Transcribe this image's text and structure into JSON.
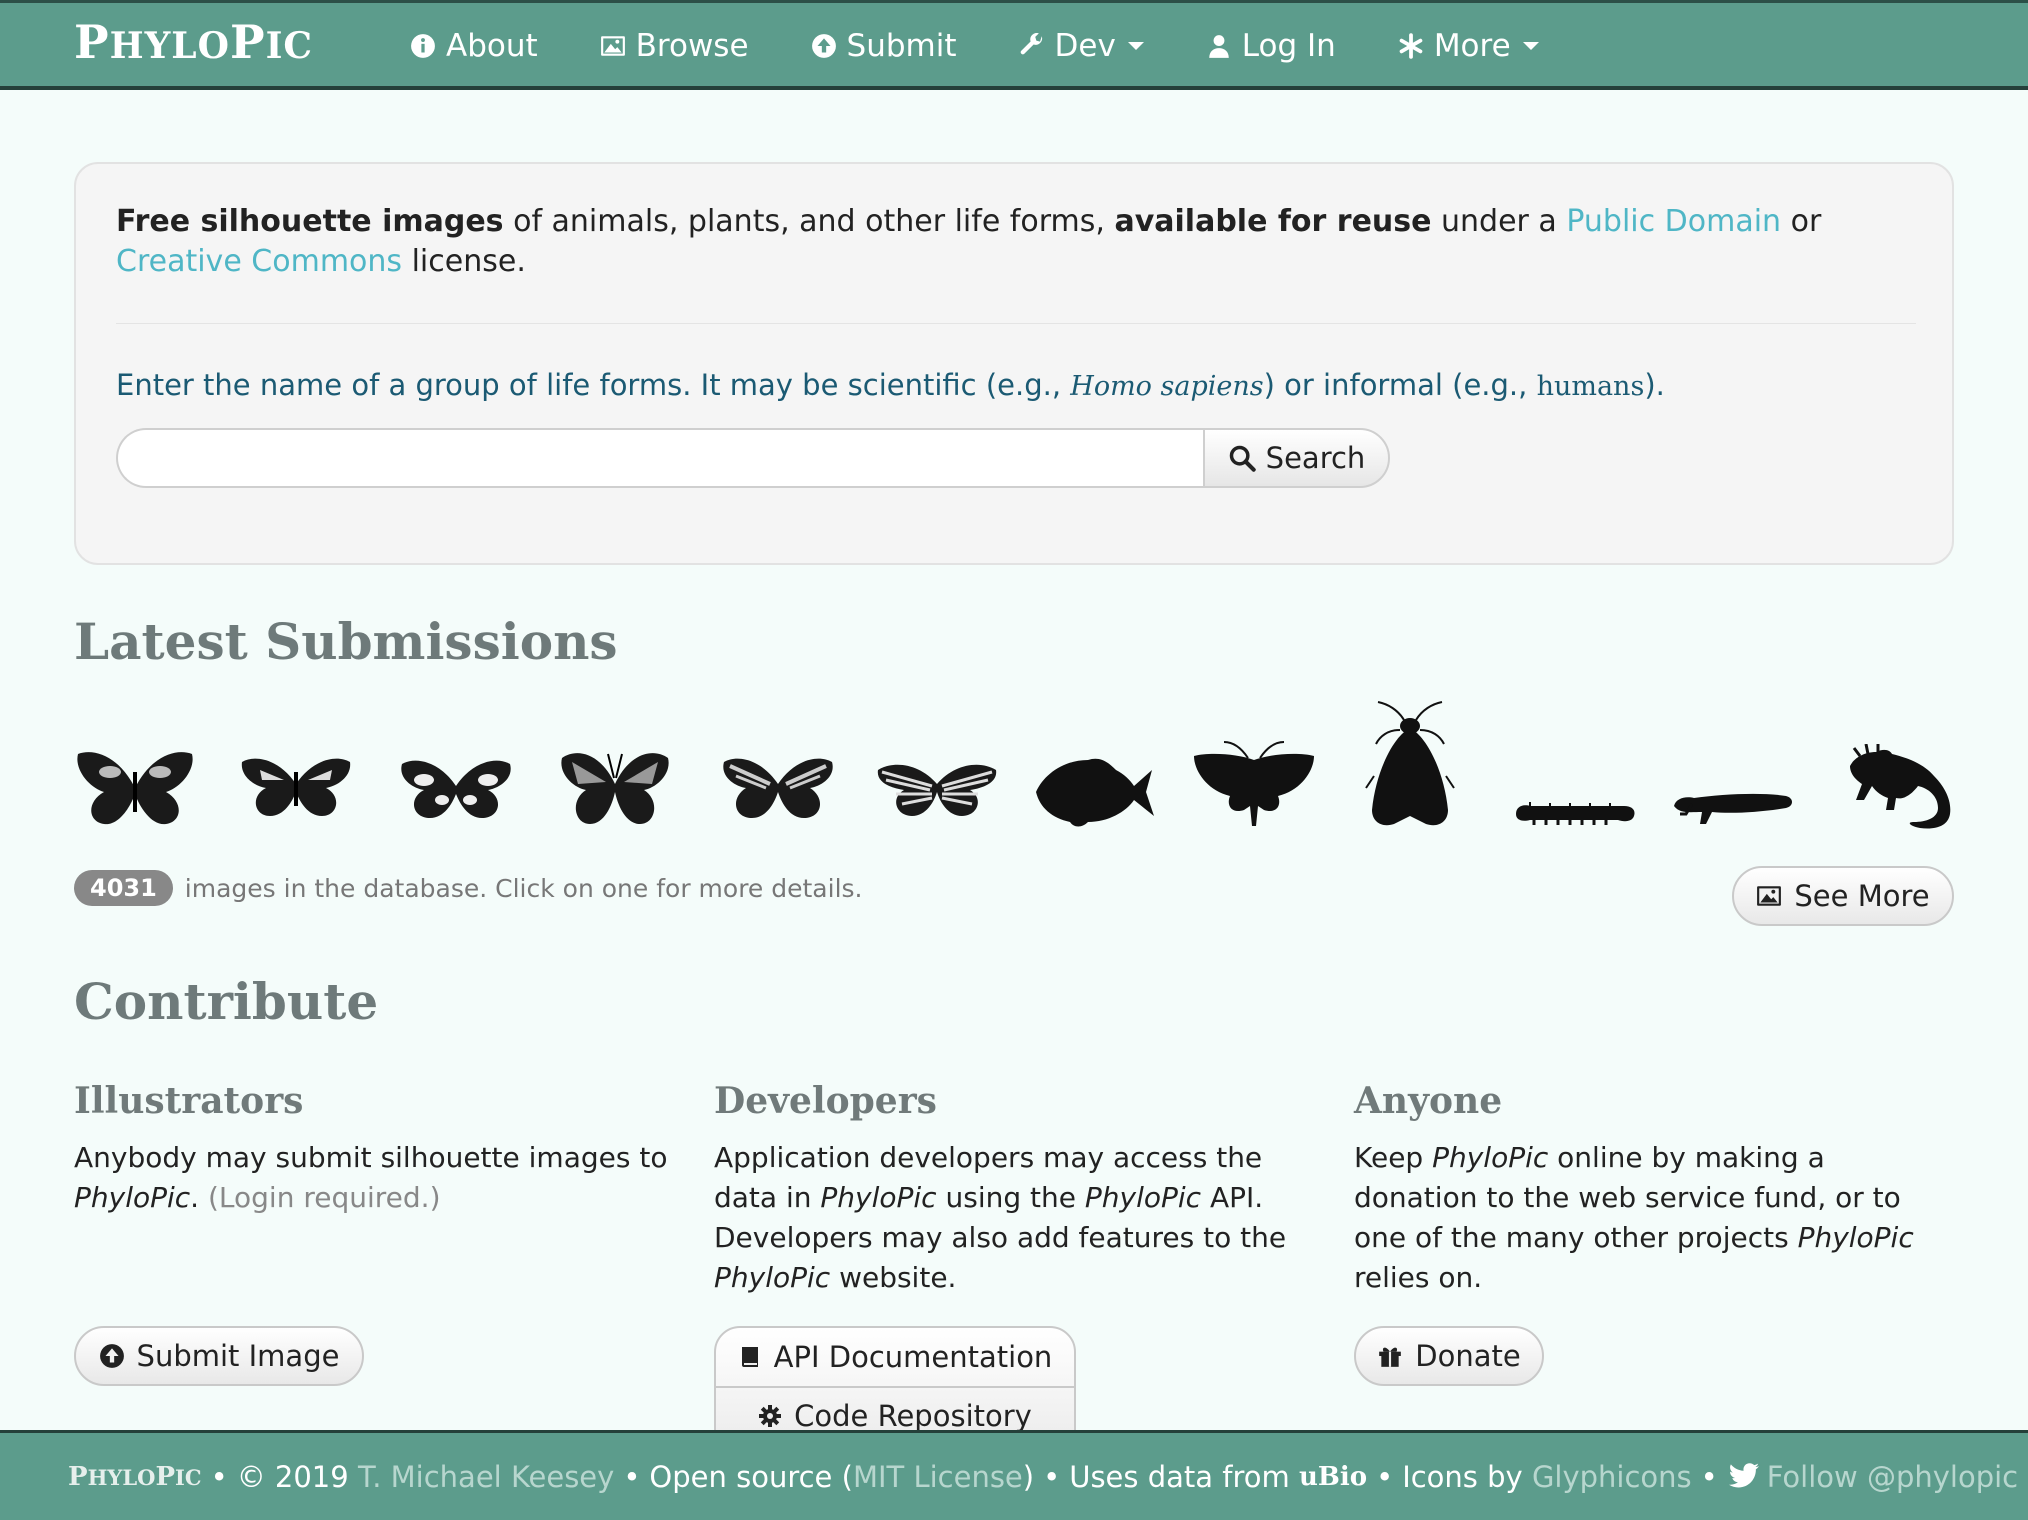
{
  "nav": {
    "brand_initial_1": "P",
    "brand_rest_1": "HYLO",
    "brand_initial_2": "P",
    "brand_rest_2": "IC",
    "items": [
      {
        "label": "About",
        "icon": "info-icon"
      },
      {
        "label": "Browse",
        "icon": "picture-icon"
      },
      {
        "label": "Submit",
        "icon": "upload-icon"
      },
      {
        "label": "Dev",
        "icon": "wrench-icon",
        "dropdown": true
      },
      {
        "label": "Log In",
        "icon": "user-icon"
      },
      {
        "label": "More",
        "icon": "asterisk-icon",
        "dropdown": true
      }
    ]
  },
  "hero": {
    "lead_bold_1": "Free silhouette images",
    "lead_text_1": " of animals, plants, and other life forms, ",
    "lead_bold_2": "available for reuse",
    "lead_text_2": " under a ",
    "link_public_domain": "Public Domain",
    "lead_text_3": " or ",
    "link_creative_commons": "Creative Commons",
    "lead_text_4": " license.",
    "prompt_1": "Enter the name of a group of life forms. It may be scientific (e.g., ",
    "prompt_example_scientific": "Homo sapiens",
    "prompt_2": ") or informal (e.g., ",
    "prompt_example_informal": "humans",
    "prompt_3": ").",
    "search_value": "",
    "search_button": "Search"
  },
  "latest": {
    "heading": "Latest Submissions",
    "thumbnails": [
      "butterfly",
      "butterfly",
      "butterfly",
      "butterfly",
      "butterfly",
      "butterfly",
      "fish",
      "moth",
      "moth",
      "caterpillar",
      "salamander",
      "lizard"
    ],
    "count": "4031",
    "count_text": "images in the database. Click on one for more details.",
    "see_more": "See More"
  },
  "contribute": {
    "heading": "Contribute",
    "illustrators": {
      "title": "Illustrators",
      "text_1": "Anybody may submit silhouette images to ",
      "text_em": "PhyloPic",
      "text_2": ". ",
      "text_muted": "(Login required.)",
      "button": "Submit Image"
    },
    "developers": {
      "title": "Developers",
      "text_1": "Application developers may access the data in ",
      "text_em_1": "PhyloPic",
      "text_2": " using the ",
      "text_em_2": "PhyloPic",
      "text_3": " API. Developers may also add features to the ",
      "text_em_3": "PhyloPic",
      "text_4": " website.",
      "button_api": "API Documentation",
      "button_code": "Code Repository"
    },
    "anyone": {
      "title": "Anyone",
      "text_1": "Keep ",
      "text_em_1": "PhyloPic",
      "text_2": " online by making a donation to the web service fund, or to one of the many other projects ",
      "text_em_2": "PhyloPic",
      "text_3": " relies on.",
      "button": "Donate"
    }
  },
  "footer": {
    "brand_initial_1": "P",
    "brand_rest_1": "HYLO",
    "brand_initial_2": "P",
    "brand_rest_2": "IC",
    "bullet": "•",
    "copyright": "© 2019",
    "author": "T. Michael Keesey",
    "open_source": "Open source (",
    "license": "MIT License",
    "close_paren": ")",
    "uses_data": "Uses data from",
    "ubio": "uBio",
    "icons_by": "Icons by",
    "glyphicons": "Glyphicons",
    "follow": "Follow @phylopic"
  },
  "colors": {
    "navbar": "#5c9c8c",
    "link": "#4fb6c6",
    "background": "#f4fcfa"
  }
}
